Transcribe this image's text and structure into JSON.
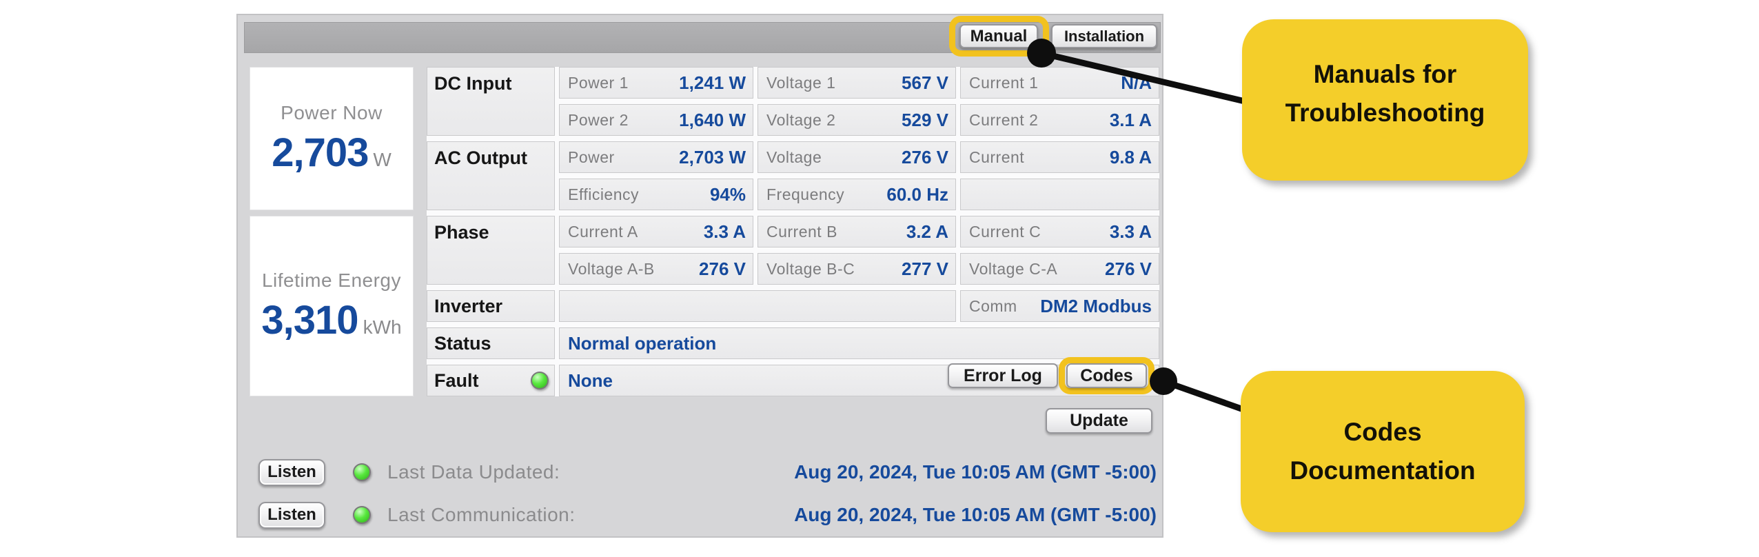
{
  "colors": {
    "accent_navy": "#164A9C",
    "panel_gray": "#D6D6D8",
    "cell_gray": "#ECECEE",
    "bubble_yellow": "#F4CE2A",
    "highlight_yellow": "#F2C21E",
    "led_green": "#4CE636"
  },
  "topbar": {
    "manual_label": "Manual",
    "installation_label": "Installation"
  },
  "summary": {
    "power_now": {
      "title": "Power Now",
      "value": "2,703",
      "unit": "W"
    },
    "lifetime_energy": {
      "title": "Lifetime Energy",
      "value": "3,310",
      "unit": "kWh"
    }
  },
  "table": {
    "dc_input": {
      "label": "DC Input",
      "rows": [
        {
          "cells": [
            {
              "label": "Power 1",
              "value": "1,241 W"
            },
            {
              "label": "Voltage 1",
              "value": "567 V"
            },
            {
              "label": "Current 1",
              "value": "N/A"
            }
          ]
        },
        {
          "cells": [
            {
              "label": "Power 2",
              "value": "1,640 W"
            },
            {
              "label": "Voltage 2",
              "value": "529 V"
            },
            {
              "label": "Current 2",
              "value": "3.1 A"
            }
          ]
        }
      ]
    },
    "ac_output": {
      "label": "AC Output",
      "rows": [
        {
          "cells": [
            {
              "label": "Power",
              "value": "2,703 W"
            },
            {
              "label": "Voltage",
              "value": "276 V"
            },
            {
              "label": "Current",
              "value": "9.8 A"
            }
          ]
        },
        {
          "cells": [
            {
              "label": "Efficiency",
              "value": "94%"
            },
            {
              "label": "Frequency",
              "value": "60.0 Hz"
            }
          ]
        }
      ]
    },
    "phase": {
      "label": "Phase",
      "rows": [
        {
          "cells": [
            {
              "label": "Current A",
              "value": "3.3 A"
            },
            {
              "label": "Current B",
              "value": "3.2 A"
            },
            {
              "label": "Current C",
              "value": "3.3 A"
            }
          ]
        },
        {
          "cells": [
            {
              "label": "Voltage A-B",
              "value": "276 V"
            },
            {
              "label": "Voltage B-C",
              "value": "277 V"
            },
            {
              "label": "Voltage C-A",
              "value": "276 V"
            }
          ]
        }
      ]
    },
    "inverter": {
      "label": "Inverter",
      "comm": {
        "label": "Comm",
        "value": "DM2 Modbus"
      }
    },
    "status": {
      "label": "Status",
      "value": "Normal operation"
    },
    "fault": {
      "label": "Fault",
      "value": "None",
      "error_log_label": "Error Log",
      "codes_label": "Codes"
    }
  },
  "footer": {
    "update_label": "Update",
    "rows": [
      {
        "button_label": "Listen",
        "label": "Last Data Updated:",
        "value": "Aug 20, 2024, Tue 10:05 AM (GMT -5:00)"
      },
      {
        "button_label": "Listen",
        "label": "Last Communication:",
        "value": "Aug 20, 2024, Tue 10:05 AM (GMT -5:00)"
      }
    ]
  },
  "annotations": {
    "manual_callout": {
      "line1": "Manuals for",
      "line2": "Troubleshooting"
    },
    "codes_callout": {
      "line1": "Codes",
      "line2": "Documentation"
    }
  }
}
